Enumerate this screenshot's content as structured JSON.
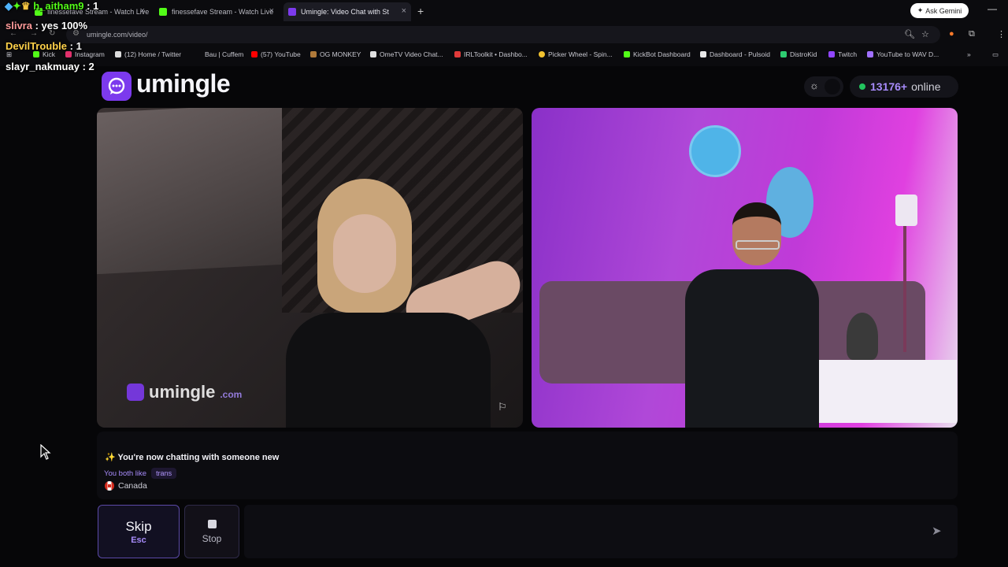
{
  "browser": {
    "tabs": [
      {
        "title": "finessefave Stream - Watch Live",
        "color": "#53fc18",
        "active": false
      },
      {
        "title": "finessefave Stream - Watch Live",
        "color": "#53fc18",
        "active": false
      },
      {
        "title": "Umingle: Video Chat with Strangers",
        "color": "#7c3aed",
        "active": true
      }
    ],
    "ask_gemini": "Ask Gemini",
    "url": "umingle.com/video/",
    "bookmarks": [
      "Kick",
      "Instagram",
      "(12) Home / Twitter",
      "Bau | Cuffem",
      "(57) YouTube",
      "OG MONKEY",
      "OmeTV Video Chat...",
      "IRLToolkit • Dashbo...",
      "Picker Wheel - Spin...",
      "KickBot Dashboard",
      "Dashboard - Pulsoid",
      "DistroKid",
      "Twitch",
      "YouTube to WAV D..."
    ]
  },
  "overlay": [
    {
      "user": "h_aitham9",
      "text": " : 1",
      "color": "#ffffff"
    },
    {
      "user": "slivra",
      "text": " : yes 100%",
      "color": "#ff9b9b"
    },
    {
      "user": "DevilTrouble",
      "text": " : 1",
      "color": "#ffd24a"
    },
    {
      "user": "slayr_nakmuay",
      "text": " : 2",
      "color": "#ffffff"
    }
  ],
  "header": {
    "logo_text": "umingle",
    "online_count": "13176+",
    "online_label": "online"
  },
  "video_left": {
    "watermark": "umingle",
    "watermark_tld": ".com"
  },
  "messages": {
    "system": "✨ You're now chatting with someone new",
    "likes_label": "You both like",
    "likes_tag": "trans",
    "country": "Canada"
  },
  "controls": {
    "skip_label": "Skip",
    "skip_key": "Esc",
    "stop_label": "Stop",
    "input_placeholder": ""
  },
  "colors": {
    "accent": "#7c3aed",
    "accent_light": "#a78bfa",
    "online": "#22c55e"
  }
}
